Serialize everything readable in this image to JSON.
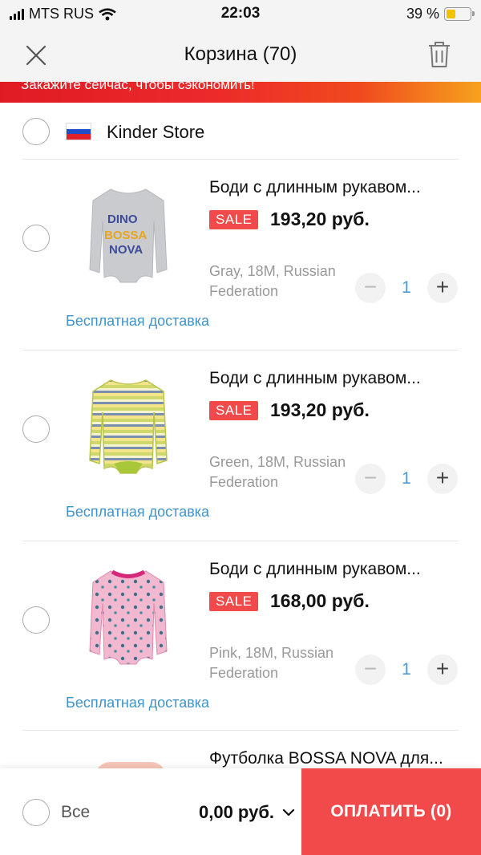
{
  "status": {
    "carrier": "MTS RUS",
    "time": "22:03",
    "battery": "39 %",
    "battery_level": 0.39
  },
  "header": {
    "title": "Корзина (70)"
  },
  "promo": {
    "text": "Закажите сейчас, чтобы сэкономить!"
  },
  "store": {
    "name": "Kinder Store"
  },
  "items": [
    {
      "title": "Боди с длинным рукавом...",
      "badge": "SALE",
      "price": "193,20 руб.",
      "variant": "Gray, 18M, Russian Federation",
      "qty": "1",
      "shipping": "Бесплатная доставка"
    },
    {
      "title": "Боди с длинным рукавом...",
      "badge": "SALE",
      "price": "193,20 руб.",
      "variant": "Green, 18M, Russian Federation",
      "qty": "1",
      "shipping": "Бесплатная доставка"
    },
    {
      "title": "Боди с длинным рукавом...",
      "badge": "SALE",
      "price": "168,00 руб.",
      "variant": "Pink, 18M, Russian Federation",
      "qty": "1",
      "shipping": "Бесплатная доставка"
    },
    {
      "title": "Футболка BOSSA NOVA для..."
    }
  ],
  "icons": {
    "minus": "−",
    "plus": "+"
  },
  "bottom": {
    "all_label": "Все",
    "total": "0,00 руб.",
    "pay_label": "ОПЛАТИТЬ (0)"
  },
  "colors": {
    "accent": "#f24a4a",
    "link": "#3f93c9",
    "qty": "#4a9bd4"
  }
}
